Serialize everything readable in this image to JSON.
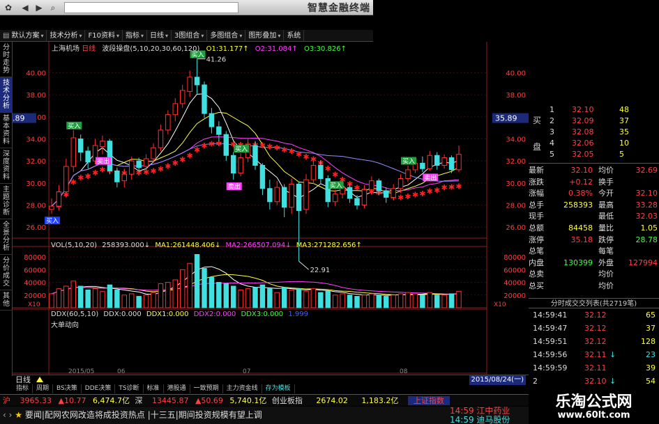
{
  "app": {
    "title": "智慧金融终端"
  },
  "toolbar": {
    "items": [
      {
        "label": "默认方案"
      },
      {
        "label": "技术分析"
      },
      {
        "label": "F10资料"
      },
      {
        "label": "指标"
      },
      {
        "label": "日线"
      },
      {
        "label": "3图组合"
      },
      {
        "label": "多图组合"
      },
      {
        "label": "图形叠加"
      },
      {
        "label": "系统"
      }
    ]
  },
  "left_tabs": [
    {
      "label": "分时走势",
      "active": false
    },
    {
      "label": "技术分析",
      "active": true
    },
    {
      "label": "基本资料",
      "active": false
    },
    {
      "label": "深度资料",
      "active": false
    },
    {
      "label": "主题诊断",
      "active": false
    },
    {
      "label": "全景分析",
      "active": false
    },
    {
      "label": "分价成交",
      "active": false
    },
    {
      "label": "其他",
      "active": false
    }
  ],
  "chart": {
    "stock_name": "上海机场",
    "period": "日线",
    "indicator": "波段操盘(5,10,20,30,60,120)",
    "o1_label": "O1:",
    "o1": "31.177",
    "o1_mark": "↑",
    "o2_label": "O2:",
    "o2": "31.084",
    "o2_mark": "↑",
    "o3_label": "O3:",
    "o3": "30.826",
    "o3_mark": "↑",
    "price_axis": [
      "40.00",
      "38.00",
      "36.00",
      "34.00",
      "32.00",
      "30.00",
      "28.00",
      "26.00"
    ],
    "current_price": "35.89",
    "high_label": "41.26",
    "low_label": "22.91",
    "tag_buy": "买入",
    "tag_sell": "卖出",
    "vol_legend": "VOL(5,10,20)",
    "vol_value": "258393.000",
    "vol_mark": "↓",
    "ma1_label": "MA1:",
    "ma1": "261448.406",
    "ma1_mark": "↓",
    "ma2_label": "MA2:",
    "ma2": "266507.094",
    "ma2_mark": "↓",
    "ma3_label": "MA3:",
    "ma3": "271282.656",
    "ma3_mark": "↑",
    "vol_axis": [
      "80000",
      "60000",
      "40000",
      "20000"
    ],
    "vol_unit": "X10",
    "ddx_legend": "DDX(60,5,10)",
    "ddx_label": "DDX:",
    "ddx": "0.000",
    "ddx1_label": "DDX1:",
    "ddx1": "0.000",
    "ddx2_label": "DDX2:",
    "ddx2": "0.000",
    "ddx3_label": "DDX3:",
    "ddx3": "0.000",
    "ddx_extra": "1.999",
    "ddx_sub": "大单动向",
    "period_tab": "日线",
    "date_label": "2015/08/24(一)",
    "x_labels": [
      "2015/05",
      "06",
      "07",
      "08"
    ]
  },
  "chart_data": {
    "type": "candlestick",
    "series": [
      {
        "open": 27.6,
        "close": 27.9,
        "high": 28.6,
        "low": 27.2,
        "vol": 22000
      },
      {
        "open": 27.9,
        "close": 29.2,
        "high": 29.8,
        "low": 27.5,
        "vol": 30000
      },
      {
        "open": 29.2,
        "close": 31.5,
        "high": 32.2,
        "low": 28.8,
        "vol": 34000
      },
      {
        "open": 31.5,
        "close": 34.1,
        "high": 34.8,
        "low": 31.0,
        "vol": 42000
      },
      {
        "open": 34.0,
        "close": 32.8,
        "high": 34.4,
        "low": 32.0,
        "vol": 34000
      },
      {
        "open": 32.9,
        "close": 31.9,
        "high": 33.3,
        "low": 31.3,
        "vol": 28000
      },
      {
        "open": 32.0,
        "close": 33.4,
        "high": 34.0,
        "low": 31.7,
        "vol": 30000
      },
      {
        "open": 33.3,
        "close": 33.8,
        "high": 34.3,
        "low": 32.6,
        "vol": 26000
      },
      {
        "open": 33.8,
        "close": 31.1,
        "high": 34.0,
        "low": 30.8,
        "vol": 36000
      },
      {
        "open": 31.1,
        "close": 30.1,
        "high": 31.4,
        "low": 29.6,
        "vol": 28000
      },
      {
        "open": 30.2,
        "close": 30.8,
        "high": 31.3,
        "low": 29.6,
        "vol": 20000
      },
      {
        "open": 30.8,
        "close": 32.0,
        "high": 32.4,
        "low": 30.3,
        "vol": 22000
      },
      {
        "open": 32.0,
        "close": 31.4,
        "high": 32.3,
        "low": 31.0,
        "vol": 18000
      },
      {
        "open": 31.5,
        "close": 32.2,
        "high": 32.6,
        "low": 31.0,
        "vol": 20000
      },
      {
        "open": 32.2,
        "close": 33.2,
        "high": 33.6,
        "low": 31.8,
        "vol": 24000
      },
      {
        "open": 33.2,
        "close": 34.8,
        "high": 35.3,
        "low": 32.9,
        "vol": 38000
      },
      {
        "open": 34.8,
        "close": 36.2,
        "high": 36.6,
        "low": 34.4,
        "vol": 40000
      },
      {
        "open": 36.2,
        "close": 37.2,
        "high": 37.7,
        "low": 35.6,
        "vol": 44000
      },
      {
        "open": 37.2,
        "close": 38.4,
        "high": 38.9,
        "low": 36.8,
        "vol": 60000
      },
      {
        "open": 38.3,
        "close": 39.6,
        "high": 40.2,
        "low": 37.8,
        "vol": 70000
      },
      {
        "open": 39.6,
        "close": 38.9,
        "high": 41.26,
        "low": 38.1,
        "vol": 84000
      },
      {
        "open": 38.9,
        "close": 36.3,
        "high": 39.2,
        "low": 35.9,
        "vol": 62000
      },
      {
        "open": 36.3,
        "close": 35.1,
        "high": 36.8,
        "low": 34.5,
        "vol": 48000
      },
      {
        "open": 35.1,
        "close": 34.4,
        "high": 35.6,
        "low": 33.8,
        "vol": 40000
      },
      {
        "open": 34.4,
        "close": 32.5,
        "high": 34.7,
        "low": 32.0,
        "vol": 38000
      },
      {
        "open": 32.5,
        "close": 30.9,
        "high": 32.8,
        "low": 30.3,
        "vol": 34000
      },
      {
        "open": 30.9,
        "close": 32.3,
        "high": 32.7,
        "low": 30.6,
        "vol": 28000
      },
      {
        "open": 32.3,
        "close": 33.5,
        "high": 34.0,
        "low": 31.9,
        "vol": 30000
      },
      {
        "open": 33.4,
        "close": 31.6,
        "high": 33.8,
        "low": 31.2,
        "vol": 32000
      },
      {
        "open": 31.6,
        "close": 29.5,
        "high": 31.8,
        "low": 28.9,
        "vol": 36000
      },
      {
        "open": 29.5,
        "close": 28.3,
        "high": 30.3,
        "low": 27.6,
        "vol": 30000
      },
      {
        "open": 28.3,
        "close": 29.6,
        "high": 30.2,
        "low": 28.0,
        "vol": 24000
      },
      {
        "open": 29.6,
        "close": 27.8,
        "high": 29.9,
        "low": 26.9,
        "vol": 32000
      },
      {
        "open": 27.8,
        "close": 29.9,
        "high": 30.4,
        "low": 27.2,
        "vol": 28000
      },
      {
        "open": 29.9,
        "close": 27.5,
        "high": 30.1,
        "low": 22.91,
        "vol": 30000
      },
      {
        "open": 27.6,
        "close": 30.3,
        "high": 30.8,
        "low": 27.2,
        "vol": 26000
      },
      {
        "open": 30.3,
        "close": 31.6,
        "high": 32.0,
        "low": 29.9,
        "vol": 30000
      },
      {
        "open": 31.6,
        "close": 30.4,
        "high": 32.0,
        "low": 30.0,
        "vol": 24000
      },
      {
        "open": 30.4,
        "close": 28.3,
        "high": 30.7,
        "low": 27.8,
        "vol": 26000
      },
      {
        "open": 28.3,
        "close": 29.0,
        "high": 29.4,
        "low": 27.9,
        "vol": 20000
      },
      {
        "open": 29.0,
        "close": 29.6,
        "high": 30.0,
        "low": 28.6,
        "vol": 22000
      },
      {
        "open": 29.6,
        "close": 28.6,
        "high": 29.9,
        "low": 28.2,
        "vol": 20000
      },
      {
        "open": 28.6,
        "close": 28.0,
        "high": 28.9,
        "low": 27.6,
        "vol": 18000
      },
      {
        "open": 28.0,
        "close": 29.4,
        "high": 29.8,
        "low": 27.7,
        "vol": 20000
      },
      {
        "open": 29.4,
        "close": 30.2,
        "high": 30.6,
        "low": 29.0,
        "vol": 22000
      },
      {
        "open": 30.2,
        "close": 29.3,
        "high": 30.4,
        "low": 28.9,
        "vol": 20000
      },
      {
        "open": 29.3,
        "close": 28.7,
        "high": 29.6,
        "low": 28.2,
        "vol": 18000
      },
      {
        "open": 28.7,
        "close": 29.5,
        "high": 29.9,
        "low": 28.4,
        "vol": 20000
      },
      {
        "open": 29.5,
        "close": 30.4,
        "high": 30.8,
        "low": 29.1,
        "vol": 22000
      },
      {
        "open": 30.4,
        "close": 31.2,
        "high": 31.6,
        "low": 30.1,
        "vol": 24000
      },
      {
        "open": 31.2,
        "close": 31.8,
        "high": 32.2,
        "low": 30.9,
        "vol": 22000
      },
      {
        "open": 31.8,
        "close": 31.3,
        "high": 32.4,
        "low": 31.0,
        "vol": 20000
      },
      {
        "open": 31.3,
        "close": 32.5,
        "high": 32.9,
        "low": 31.1,
        "vol": 24000
      },
      {
        "open": 32.5,
        "close": 31.6,
        "high": 32.8,
        "low": 31.2,
        "vol": 20000
      },
      {
        "open": 31.6,
        "close": 32.3,
        "high": 32.6,
        "low": 31.3,
        "vol": 20000
      },
      {
        "open": 32.3,
        "close": 31.2,
        "high": 32.5,
        "low": 30.9,
        "vol": 22000
      },
      {
        "open": 31.2,
        "close": 32.6,
        "high": 33.4,
        "low": 31.0,
        "vol": 26000
      }
    ],
    "price_ylim": [
      25,
      41.8
    ],
    "vol_ylim": [
      0,
      90000
    ]
  },
  "quote": {
    "ask_prices": [
      "32.10",
      "32.09",
      "32.08",
      "32.06",
      "32.05"
    ],
    "ask_vols": [
      "48",
      "37",
      "35",
      "10",
      "5"
    ],
    "ask_nums": [
      "1",
      "2",
      "3",
      "4",
      "5"
    ],
    "ask_label1": "买",
    "ask_label2": "盘",
    "rows": [
      {
        "l1": "最新",
        "v1": "32.10",
        "l2": "均价",
        "v2": "32.69",
        "c1": "#ff4040",
        "c2": "#ff4040"
      },
      {
        "l1": "涨跌",
        "v1": "+0.12",
        "l2": "换手",
        "v2": "",
        "c1": "#ff4040",
        "c2": "#ddd"
      },
      {
        "l1": "涨幅",
        "v1": "0.38%",
        "l2": "今开",
        "v2": "32.10",
        "c1": "#ff4040",
        "c2": "#ff4040"
      },
      {
        "l1": "总手",
        "v1": "258393",
        "l2": "最高",
        "v2": "33.28",
        "c1": "#ffff40",
        "c2": "#ff4040"
      },
      {
        "l1": "现手",
        "v1": "",
        "l2": "最低",
        "v2": "32.03",
        "c1": "#ffff40",
        "c2": "#ff4040"
      },
      {
        "l1": "总额",
        "v1": "84458",
        "l2": "量比",
        "v2": "1.05",
        "c1": "#ffff40",
        "c2": "#ffff40"
      },
      {
        "l1": "涨停",
        "v1": "35.18",
        "l2": "跌停",
        "v2": "28.78",
        "c1": "#ff4040",
        "c2": "#40ff40"
      },
      {
        "l1": "总笔",
        "v1": "",
        "l2": "每笔",
        "v2": "",
        "c1": "#ddd",
        "c2": "#ddd"
      },
      {
        "l1": "内盘",
        "v1": "130399",
        "l2": "外盘",
        "v2": "127994",
        "c1": "#40ff40",
        "c2": "#ff4040"
      },
      {
        "l1": "总卖",
        "v1": "",
        "l2": "均价",
        "v2": "",
        "c1": "#ddd",
        "c2": "#ddd"
      },
      {
        "l1": "总买",
        "v1": "",
        "l2": "均价",
        "v2": "",
        "c1": "#ddd",
        "c2": "#ddd"
      }
    ],
    "trades_title": "分时成交交列表(共2719笔)",
    "trades": [
      {
        "time": "14:59:41",
        "price": "32.12",
        "vol": "65",
        "dir": ""
      },
      {
        "time": "14:59:47",
        "price": "32.12",
        "vol": "37",
        "dir": ""
      },
      {
        "time": "14:59:51",
        "price": "32.12",
        "vol": "128",
        "dir": ""
      },
      {
        "time": "14:59:56",
        "price": "32.11",
        "vol": "23",
        "dir": "↓"
      },
      {
        "time": "14:59:59",
        "price": "32.11",
        "vol": "39",
        "dir": ""
      },
      {
        "time": "2",
        "price": "32.10",
        "vol": "54",
        "dir": "↓"
      }
    ]
  },
  "bottom_tabs": [
    {
      "label": "指标"
    },
    {
      "label": "周期"
    },
    {
      "label": "BS决策"
    },
    {
      "label": "DDE决策"
    },
    {
      "label": "TS诊断"
    },
    {
      "label": "标准"
    },
    {
      "label": "港股通"
    },
    {
      "label": "一致预期"
    },
    {
      "label": "主力资金线"
    },
    {
      "label": "存为模板"
    }
  ],
  "status": {
    "sh_label": "沪",
    "sh_index": "3965.33",
    "sh_change": "▲10.77",
    "sh_amount": "6,474.7亿",
    "sz_label": "深",
    "sz_index": "13445.87",
    "sz_change": "▲50.69",
    "sz_amount": "5,740.1亿",
    "cy_label": "创业板指",
    "cy_index": "2674.02",
    "cy_amount": "1,183.2亿",
    "idx_tag": "上证指数"
  },
  "ticker": {
    "text": "要闻|配网农网改造将成投资热点  |十三五|期间投资规模有望上调",
    "alert1": "14:59 江中药业",
    "alert2": "14:59 迪马股份"
  },
  "watermark": {
    "title": "乐淘公式网",
    "url": "www.60lt.com"
  },
  "colors": {
    "up": "#ff3030",
    "down": "#40e0e0",
    "ma5": "#ffffff",
    "ma10": "#ffff40",
    "ma20": "#ff40ff",
    "sar_down": "#ff2020",
    "sar_up": "#40ff40"
  }
}
